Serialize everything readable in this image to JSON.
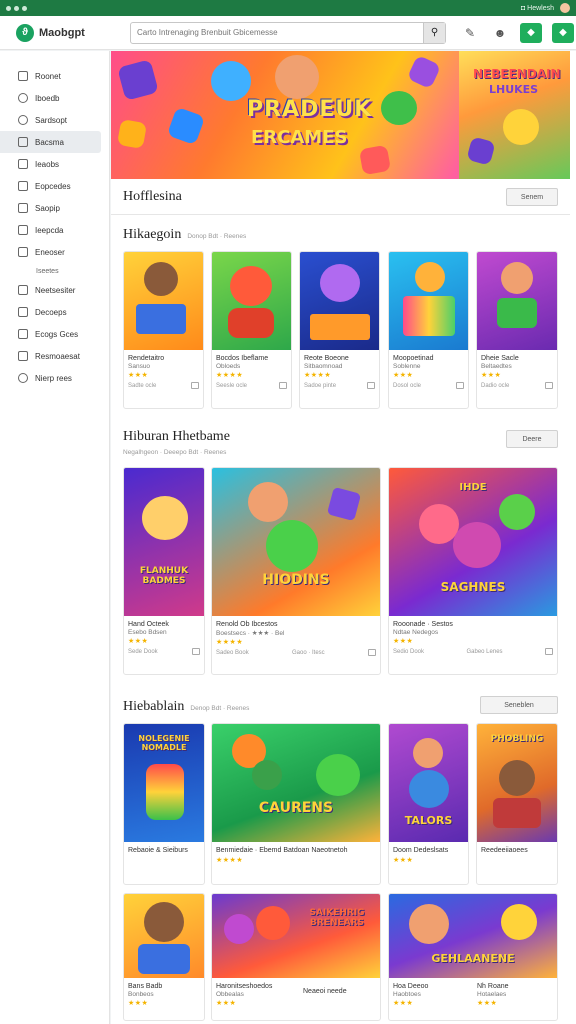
{
  "system": {
    "left_text": "",
    "right_text": "◘ Hewlesh"
  },
  "app": {
    "name": "Maobgpt"
  },
  "search": {
    "placeholder": "Carto Intrenaging Brenbuit Gbicemesse"
  },
  "sidebar": {
    "items": [
      {
        "label": "Roonet",
        "icon": "home-icon"
      },
      {
        "label": "Iboedb",
        "icon": "compass-icon"
      },
      {
        "label": "Sardsopt",
        "icon": "tag-icon"
      },
      {
        "label": "Bacsma",
        "icon": "grid-icon",
        "active": true
      },
      {
        "label": "Ieaobs",
        "icon": "folder-icon"
      },
      {
        "label": "Eopcedes",
        "icon": "list-icon"
      },
      {
        "label": "Saopip",
        "icon": "star-icon"
      },
      {
        "label": "Ieepcda",
        "icon": "film-icon"
      },
      {
        "label": "Eneoser",
        "icon": "user-icon"
      },
      {
        "label": "Iseetes",
        "icon": "",
        "sub": true
      },
      {
        "label": "Neetsesiter",
        "icon": "chart-icon"
      },
      {
        "label": "Decoeps",
        "icon": "doc-icon"
      },
      {
        "label": "Ecogs Gces",
        "icon": "box-icon"
      },
      {
        "label": "Resmoaesat",
        "icon": "settings-icon"
      },
      {
        "label": "Nierp rees",
        "icon": "help-icon"
      }
    ]
  },
  "banner": {
    "title": "PRADEUK",
    "subtitle": "ERCAMES",
    "side_title": "NEBEENDAIN",
    "side_sub": "LHUKES"
  },
  "sections": {
    "top": {
      "title": "Hofflesina",
      "button": "Senem"
    },
    "s1": {
      "title": "Hikaegoin",
      "meta": "Donop Bdt · Reenes"
    },
    "s2": {
      "title": "Hiburan Hhetbame",
      "sub": "Negalhgeon · Deeepo Bdt · Reenes",
      "button": "Deere"
    },
    "s3": {
      "title": "Hiebablain",
      "meta": "Denop Bdt · Reenes",
      "button": "Seneblen"
    }
  },
  "row1": [
    {
      "title": "Rendetaitro",
      "sub": "Sansuo",
      "stars": "★★★",
      "foot": "Sadte ocle"
    },
    {
      "title": "Bocdos Ibeflame",
      "sub": "Obloeds",
      "stars": "★★★★",
      "foot": "Seesle ocle"
    },
    {
      "title": "Reote Boeone",
      "sub": "Sitbaomnoad",
      "stars": "★★★★",
      "foot": "Sadoe pinte"
    },
    {
      "title": "Moopoetinad",
      "sub": "Soblenne",
      "stars": "★★★",
      "foot": "Dosol ocle"
    },
    {
      "title": "Dheie Sacle",
      "sub": "Beltaedtes",
      "stars": "★★★",
      "foot": "Dadio ocle"
    }
  ],
  "row2": [
    {
      "title": "Hand Octeek",
      "sub": "Esebo Bdsen",
      "stars": "★★★",
      "foot": "Sede Dook",
      "thumb_text": "FLANHUK BADMES"
    },
    {
      "title": "Renold Ob Ibcestos",
      "sub": "Boestsecs · ★★★ · Bel",
      "stars": "★★★★",
      "foot": "Sadeo Book",
      "thumb_text": "HIODINS",
      "foot2": "Gaoo · Itesc"
    },
    {
      "title": "Rooonade · Sestos",
      "sub": "Ndtae Nedegos",
      "stars": "★★★",
      "foot": "Sedio Dook",
      "thumb_text": "SAGHNES",
      "thumb_top": "IHDE",
      "foot2": "Gabeo Lenes"
    }
  ],
  "row3": [
    {
      "title": "Rebaoie & Sieiburs",
      "sub": "",
      "stars": "",
      "thumb_text": "NOLEGENIE NOMADLE"
    },
    {
      "title": "Benmiedaie · Ebemd Batdoan Naeotnetoh",
      "sub": "★★★★ · Ba",
      "stars": "★★★★",
      "thumb_text": "CAURENS"
    },
    {
      "title": "Doom Dedeslsats",
      "sub": "",
      "stars": "★★★",
      "thumb_text": "TALORS"
    },
    {
      "title": "Reedeeiiaoees",
      "sub": "",
      "stars": "",
      "thumb_text": "PHOBLING"
    }
  ],
  "row4": [
    {
      "title": "Bans Badb",
      "sub": "Bonbeos",
      "stars": "★★★"
    },
    {
      "title": "Haronitseshoedos",
      "sub": "Obbealas",
      "stars": "★★★",
      "thumb_text": "SAIKEHRIG BRENEARS"
    },
    {
      "title": "Neaeoi neede",
      "sub": "",
      "stars": ""
    },
    {
      "title": "Hoa Deeoo",
      "sub": "Haobtoes",
      "stars": "★★★",
      "thumb_text": "GEHLAANENE"
    },
    {
      "title": "Nh Roane",
      "sub": "Hotaelaes",
      "stars": "★★★"
    }
  ]
}
